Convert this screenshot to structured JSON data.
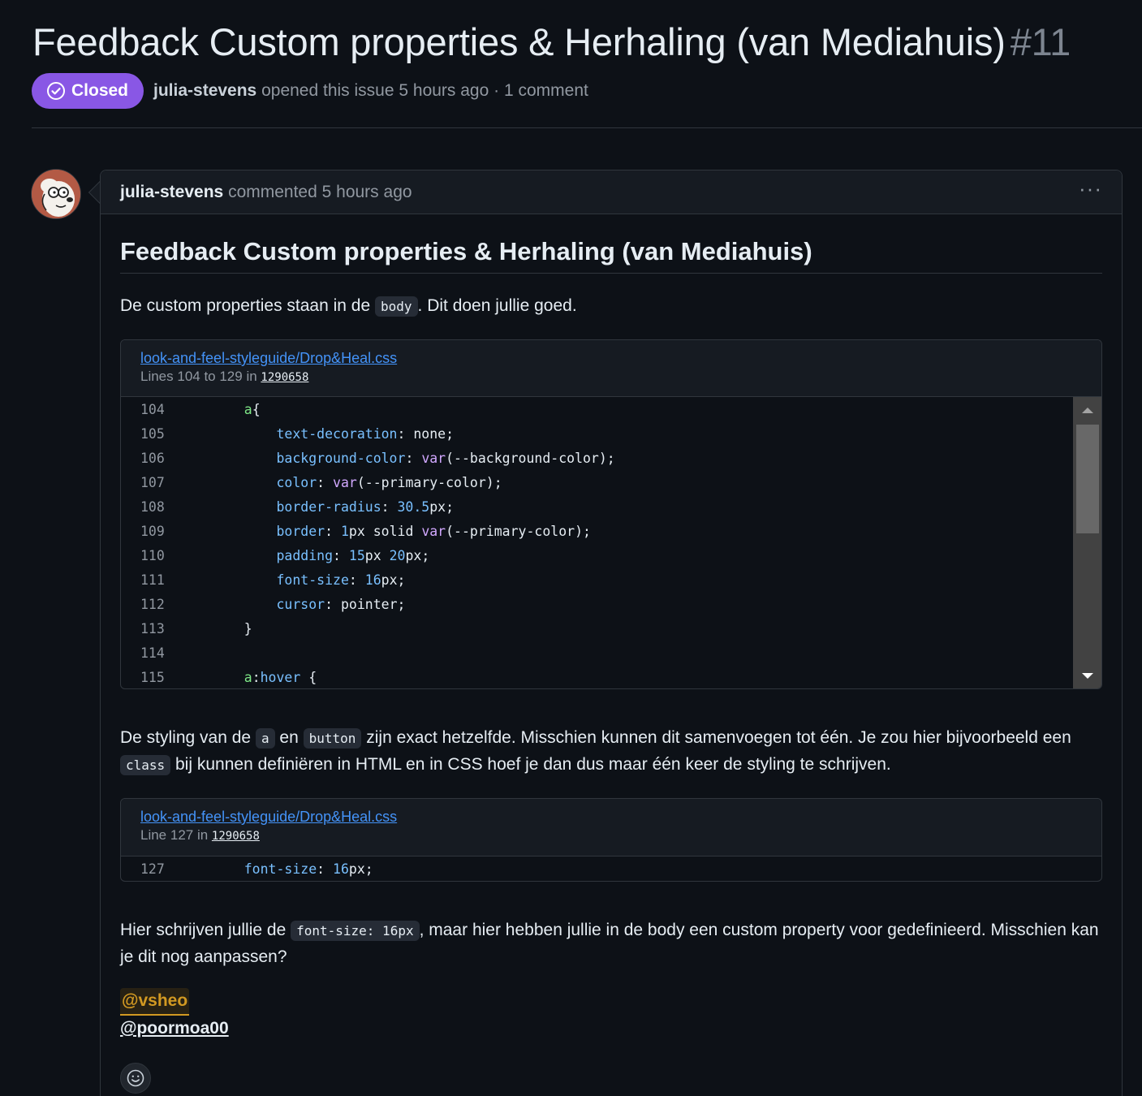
{
  "issue": {
    "title": "Feedback Custom properties & Herhaling (van Mediahuis)",
    "number": "#11",
    "state_label": "Closed",
    "author": "julia-stevens",
    "opened_text": "opened this issue 5 hours ago · 1 comment"
  },
  "comment": {
    "author": "julia-stevens",
    "time_text": "commented 5 hours ago",
    "menu_label": "···",
    "heading": "Feedback Custom properties & Herhaling (van Mediahuis)",
    "p1": {
      "before": "De custom properties staan in de ",
      "code": "body",
      "after": ". Dit doen jullie goed."
    },
    "snippet1": {
      "file": "look-and-feel-styleguide/Drop&Heal.css",
      "range_text": "Lines 104 to 129 in ",
      "sha": "1290658",
      "lines": [
        {
          "n": "104",
          "tokens": [
            {
              "t": "    ",
              "c": "t-txt"
            },
            {
              "t": "a",
              "c": "t-sel"
            },
            {
              "t": "{",
              "c": "t-txt"
            }
          ]
        },
        {
          "n": "105",
          "tokens": [
            {
              "t": "        ",
              "c": "t-txt"
            },
            {
              "t": "text-decoration",
              "c": "t-prop"
            },
            {
              "t": ": none;",
              "c": "t-txt"
            }
          ]
        },
        {
          "n": "106",
          "tokens": [
            {
              "t": "        ",
              "c": "t-txt"
            },
            {
              "t": "background-color",
              "c": "t-prop"
            },
            {
              "t": ": ",
              "c": "t-txt"
            },
            {
              "t": "var",
              "c": "t-fn"
            },
            {
              "t": "(--background-color);",
              "c": "t-txt"
            }
          ]
        },
        {
          "n": "107",
          "tokens": [
            {
              "t": "        ",
              "c": "t-txt"
            },
            {
              "t": "color",
              "c": "t-prop"
            },
            {
              "t": ": ",
              "c": "t-txt"
            },
            {
              "t": "var",
              "c": "t-fn"
            },
            {
              "t": "(--primary-color);",
              "c": "t-txt"
            }
          ]
        },
        {
          "n": "108",
          "tokens": [
            {
              "t": "        ",
              "c": "t-txt"
            },
            {
              "t": "border-radius",
              "c": "t-prop"
            },
            {
              "t": ": ",
              "c": "t-txt"
            },
            {
              "t": "30.5",
              "c": "t-num"
            },
            {
              "t": "px;",
              "c": "t-txt"
            }
          ]
        },
        {
          "n": "109",
          "tokens": [
            {
              "t": "        ",
              "c": "t-txt"
            },
            {
              "t": "border",
              "c": "t-prop"
            },
            {
              "t": ": ",
              "c": "t-txt"
            },
            {
              "t": "1",
              "c": "t-num"
            },
            {
              "t": "px solid ",
              "c": "t-txt"
            },
            {
              "t": "var",
              "c": "t-fn"
            },
            {
              "t": "(--primary-color);",
              "c": "t-txt"
            }
          ]
        },
        {
          "n": "110",
          "tokens": [
            {
              "t": "        ",
              "c": "t-txt"
            },
            {
              "t": "padding",
              "c": "t-prop"
            },
            {
              "t": ": ",
              "c": "t-txt"
            },
            {
              "t": "15",
              "c": "t-num"
            },
            {
              "t": "px ",
              "c": "t-txt"
            },
            {
              "t": "20",
              "c": "t-num"
            },
            {
              "t": "px;",
              "c": "t-txt"
            }
          ]
        },
        {
          "n": "111",
          "tokens": [
            {
              "t": "        ",
              "c": "t-txt"
            },
            {
              "t": "font-size",
              "c": "t-prop"
            },
            {
              "t": ": ",
              "c": "t-txt"
            },
            {
              "t": "16",
              "c": "t-num"
            },
            {
              "t": "px;",
              "c": "t-txt"
            }
          ]
        },
        {
          "n": "112",
          "tokens": [
            {
              "t": "        ",
              "c": "t-txt"
            },
            {
              "t": "cursor",
              "c": "t-prop"
            },
            {
              "t": ": pointer;",
              "c": "t-txt"
            }
          ]
        },
        {
          "n": "113",
          "tokens": [
            {
              "t": "    }",
              "c": "t-txt"
            }
          ]
        },
        {
          "n": "114",
          "tokens": []
        },
        {
          "n": "115",
          "tokens": [
            {
              "t": "    ",
              "c": "t-txt"
            },
            {
              "t": "a",
              "c": "t-sel"
            },
            {
              "t": ":",
              "c": "t-txt"
            },
            {
              "t": "hover",
              "c": "t-prop"
            },
            {
              "t": " {",
              "c": "t-txt"
            }
          ]
        }
      ]
    },
    "p2": {
      "s1": "De styling van de ",
      "c1": "a",
      "s2": " en ",
      "c2": "button",
      "s3": " zijn exact hetzelfde. Misschien kunnen dit samenvoegen tot één. Je zou hier bijvoorbeeld een ",
      "c3": "class",
      "s4": " bij kunnen definiëren in HTML en in CSS hoef je dan dus maar één keer de styling te schrijven."
    },
    "snippet2": {
      "file": "look-and-feel-styleguide/Drop&Heal.css",
      "range_text": "Line 127 in ",
      "sha": "1290658",
      "lines": [
        {
          "n": "127",
          "tokens": [
            {
              "t": "    ",
              "c": "t-txt"
            },
            {
              "t": "font-size",
              "c": "t-prop"
            },
            {
              "t": ": ",
              "c": "t-txt"
            },
            {
              "t": "16",
              "c": "t-num"
            },
            {
              "t": "px;",
              "c": "t-txt"
            }
          ]
        }
      ]
    },
    "p3": {
      "before": "Hier schrijven jullie de ",
      "code": "font-size: 16px",
      "after": ", maar hier hebben jullie in de body een custom property voor gedefinieerd. Misschien kan je dit nog aanpassen?"
    },
    "mentions": [
      "@vsheo",
      "@poormoa00"
    ]
  },
  "colors": {
    "background": "#0d1117",
    "closed_badge": "#8957e5",
    "link": "#4493f8",
    "mention_self": "#d29922"
  },
  "icons": [
    "issue-closed-icon",
    "kebab-menu-icon",
    "scroll-up-arrow-icon",
    "scroll-down-arrow-icon",
    "smiley-icon"
  ]
}
